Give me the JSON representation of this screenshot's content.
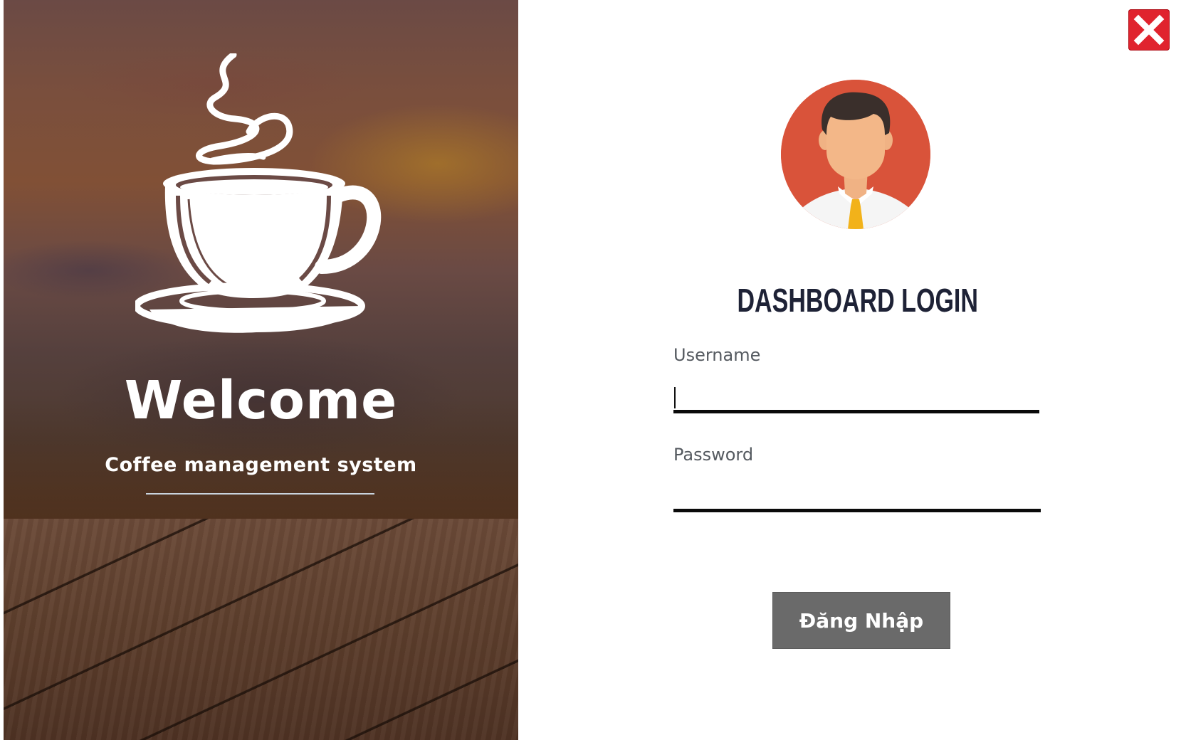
{
  "left_panel": {
    "welcome": "Welcome",
    "subtitle": "Coffee management system",
    "icon": "coffee-cup-icon"
  },
  "login": {
    "title": "DASHBOARD LOGIN",
    "avatar_icon": "user-avatar-icon",
    "username": {
      "label": "Username",
      "value": ""
    },
    "password": {
      "label": "Password",
      "value": ""
    },
    "submit_label": "Đăng Nhập",
    "close_icon": "close-icon"
  },
  "colors": {
    "close_button": "#e0232e",
    "avatar_bg": "#d9533a",
    "title": "#1e2236",
    "button_bg": "#6a6a6a",
    "input_underline": "#0a0a0a"
  }
}
